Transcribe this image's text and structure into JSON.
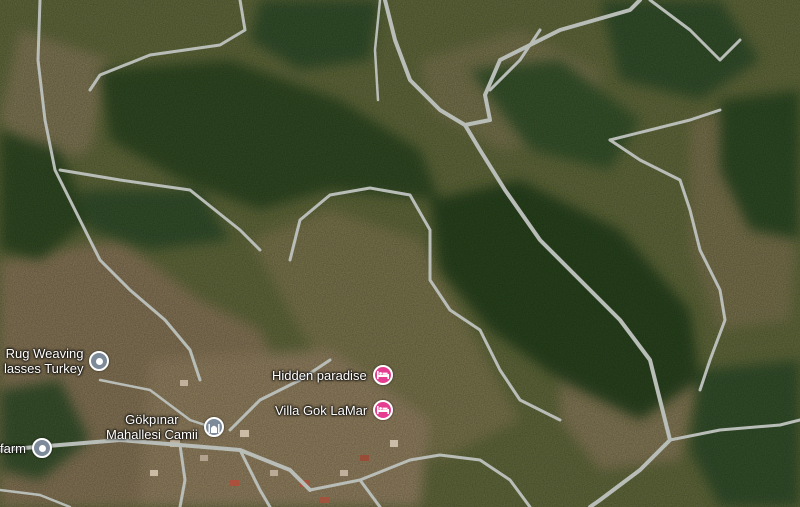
{
  "map": {
    "view": "satellite",
    "places": [
      {
        "id": "rug-weaving",
        "lines": [
          "Rug Weaving",
          "lasses Turkey"
        ],
        "icon": "place-pin-icon"
      },
      {
        "id": "hidden-paradise",
        "lines": [
          "Hidden paradise"
        ],
        "icon": "hotel-bed-icon"
      },
      {
        "id": "villa-gok-lamar",
        "lines": [
          "Villa Gok LaMar"
        ],
        "icon": "hotel-bed-icon"
      },
      {
        "id": "gokpinar-camii",
        "lines": [
          "Gökpınar",
          "Mahallesi Camii"
        ],
        "icon": "mosque-icon"
      },
      {
        "id": "farm",
        "lines": [
          "farm"
        ],
        "icon": "place-pin-icon"
      }
    ]
  },
  "colors": {
    "forest": "#2f4a23",
    "terrain": "#6e7244",
    "bare_ground": "#8d7a5c",
    "road": "#b9bdb8",
    "hotel_pin": "#e53d8f",
    "place_pin": "#7d8a99"
  }
}
